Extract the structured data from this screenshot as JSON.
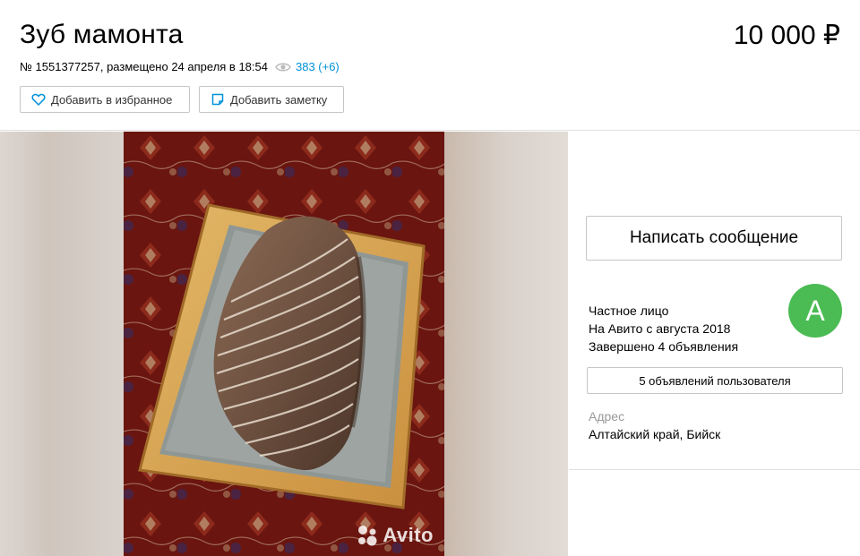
{
  "listing": {
    "title": "Зуб мамонта",
    "price": "10 000 ₽",
    "meta_text": "№ 1551377257, размещено 24 апреля в 18:54",
    "views": "383 (+6)"
  },
  "actions": {
    "favorite_label": "Добавить в избранное",
    "note_label": "Добавить заметку"
  },
  "gallery": {
    "watermark": "Avito"
  },
  "seller": {
    "message_button": "Написать сообщение",
    "type": "Частное лицо",
    "since": "На Авито с августа 2018",
    "completed": "Завершено 4 объявления",
    "avatar_letter": "А",
    "ads_button": "5 объявлений пользователя",
    "address_label": "Адрес",
    "address": "Алтайский край, Бийск"
  },
  "colors": {
    "link": "#0091d9",
    "avatar_bg": "#4bbb53"
  }
}
